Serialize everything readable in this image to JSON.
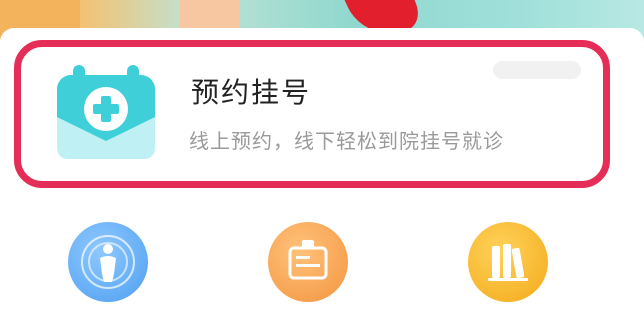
{
  "banner": {
    "ribbon_color": "#e21f2c",
    "accent_colors": [
      "#f6c070",
      "#8fd8cf"
    ]
  },
  "appointment_card": {
    "title": "预约挂号",
    "subtitle": "线上预约，线下轻松到院挂号就诊",
    "icon": "calendar-plus-icon",
    "highlight_color": "#e52e57",
    "icon_color": "#3ecfd8"
  },
  "grid": {
    "items": [
      {
        "icon": "body-scan-icon",
        "label": "",
        "color": "#5aa9f0"
      },
      {
        "icon": "id-card-icon",
        "label": "",
        "color": "#f5a04a"
      },
      {
        "icon": "books-icon",
        "label": "",
        "color": "#f5b524"
      }
    ]
  }
}
